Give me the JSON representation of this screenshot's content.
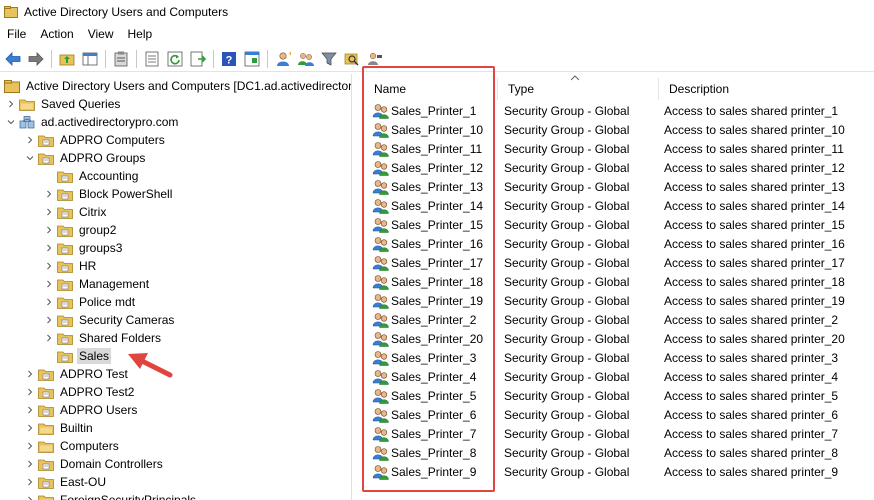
{
  "window": {
    "title": "Active Directory Users and Computers"
  },
  "menu": [
    "File",
    "Action",
    "View",
    "Help"
  ],
  "toolbar": {
    "icons": [
      "back-arrow-icon",
      "forward-arrow-icon",
      "folder-up-icon",
      "show-console-tree-icon",
      "clipboard-icon",
      "properties-icon",
      "refresh-icon",
      "export-list-icon",
      "help-icon",
      "mmc-icon",
      "new-user-icon",
      "new-group-icon",
      "filter-icon",
      "find-icon",
      "delegate-icon"
    ]
  },
  "tree": {
    "root": "Active Directory Users and Computers [DC1.ad.activedirector",
    "items": [
      {
        "label": "Saved Queries",
        "depth": 1,
        "expander": "collapsed"
      },
      {
        "label": "ad.activedirectorypro.com",
        "depth": 1,
        "expander": "expanded",
        "icon": "domain"
      },
      {
        "label": "ADPRO Computers",
        "depth": 2,
        "expander": "collapsed"
      },
      {
        "label": "ADPRO Groups",
        "depth": 2,
        "expander": "expanded"
      },
      {
        "label": "Accounting",
        "depth": 3,
        "expander": "none"
      },
      {
        "label": "Block PowerShell",
        "depth": 3,
        "expander": "collapsed"
      },
      {
        "label": "Citrix",
        "depth": 3,
        "expander": "collapsed"
      },
      {
        "label": "group2",
        "depth": 3,
        "expander": "collapsed"
      },
      {
        "label": "groups3",
        "depth": 3,
        "expander": "collapsed"
      },
      {
        "label": "HR",
        "depth": 3,
        "expander": "collapsed"
      },
      {
        "label": "Management",
        "depth": 3,
        "expander": "collapsed"
      },
      {
        "label": "Police mdt",
        "depth": 3,
        "expander": "collapsed"
      },
      {
        "label": "Security Cameras",
        "depth": 3,
        "expander": "collapsed"
      },
      {
        "label": "Shared Folders",
        "depth": 3,
        "expander": "collapsed"
      },
      {
        "label": "Sales",
        "depth": 3,
        "expander": "none",
        "selected": true
      },
      {
        "label": "ADPRO Test",
        "depth": 2,
        "expander": "collapsed"
      },
      {
        "label": "ADPRO Test2",
        "depth": 2,
        "expander": "collapsed"
      },
      {
        "label": "ADPRO Users",
        "depth": 2,
        "expander": "collapsed"
      },
      {
        "label": "Builtin",
        "depth": 2,
        "expander": "collapsed"
      },
      {
        "label": "Computers",
        "depth": 2,
        "expander": "collapsed"
      },
      {
        "label": "Domain Controllers",
        "depth": 2,
        "expander": "collapsed"
      },
      {
        "label": "East-OU",
        "depth": 2,
        "expander": "collapsed"
      },
      {
        "label": "ForeignSecurityPrincipals",
        "depth": 2,
        "expander": "collapsed"
      }
    ]
  },
  "list": {
    "columns": [
      "Name",
      "Type",
      "Description"
    ],
    "rows": [
      [
        "Sales_Printer_1",
        "Security Group - Global",
        "Access to sales shared printer_1"
      ],
      [
        "Sales_Printer_10",
        "Security Group - Global",
        "Access to sales shared printer_10"
      ],
      [
        "Sales_Printer_11",
        "Security Group - Global",
        "Access to sales shared printer_11"
      ],
      [
        "Sales_Printer_12",
        "Security Group - Global",
        "Access to sales shared printer_12"
      ],
      [
        "Sales_Printer_13",
        "Security Group - Global",
        "Access to sales shared printer_13"
      ],
      [
        "Sales_Printer_14",
        "Security Group - Global",
        "Access to sales shared printer_14"
      ],
      [
        "Sales_Printer_15",
        "Security Group - Global",
        "Access to sales shared printer_15"
      ],
      [
        "Sales_Printer_16",
        "Security Group - Global",
        "Access to sales shared printer_16"
      ],
      [
        "Sales_Printer_17",
        "Security Group - Global",
        "Access to sales shared printer_17"
      ],
      [
        "Sales_Printer_18",
        "Security Group - Global",
        "Access to sales shared printer_18"
      ],
      [
        "Sales_Printer_19",
        "Security Group - Global",
        "Access to sales shared printer_19"
      ],
      [
        "Sales_Printer_2",
        "Security Group - Global",
        "Access to sales shared printer_2"
      ],
      [
        "Sales_Printer_20",
        "Security Group - Global",
        "Access to sales shared printer_20"
      ],
      [
        "Sales_Printer_3",
        "Security Group - Global",
        "Access to sales shared printer_3"
      ],
      [
        "Sales_Printer_4",
        "Security Group - Global",
        "Access to sales shared printer_4"
      ],
      [
        "Sales_Printer_5",
        "Security Group - Global",
        "Access to sales shared printer_5"
      ],
      [
        "Sales_Printer_6",
        "Security Group - Global",
        "Access to sales shared printer_6"
      ],
      [
        "Sales_Printer_7",
        "Security Group - Global",
        "Access to sales shared printer_7"
      ],
      [
        "Sales_Printer_8",
        "Security Group - Global",
        "Access to sales shared printer_8"
      ],
      [
        "Sales_Printer_9",
        "Security Group - Global",
        "Access to sales shared printer_9"
      ]
    ]
  },
  "colors": {
    "highlight": "#e0453f",
    "selected_bg": "#d9d9d9",
    "folder": "#e8c25a"
  }
}
